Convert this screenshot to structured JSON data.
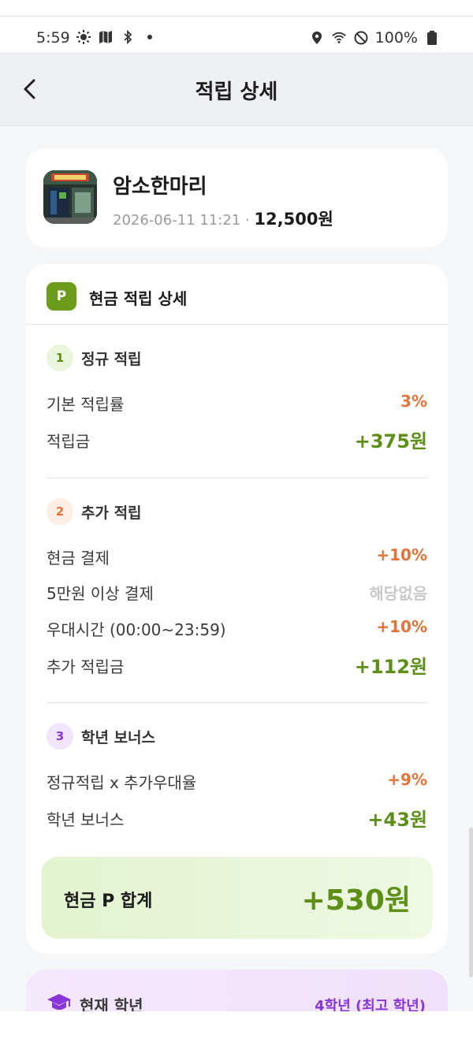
{
  "status_bar": {
    "time": "5:59",
    "battery": "100%",
    "left_icons": [
      "sun-icon",
      "map-icon",
      "bluetooth-icon",
      "dot-icon"
    ],
    "right_icons": [
      "location-icon",
      "wifi-icon",
      "do-not-disturb-icon",
      "battery-icon"
    ]
  },
  "header": {
    "title": "적립 상세",
    "back_icon": "chevron-left-icon"
  },
  "store": {
    "name": "암소한마리",
    "datetime": "2026-06-11 11:21",
    "separator": "·",
    "amount": "12,500원"
  },
  "detail": {
    "badge": "P",
    "title": "현금 적립 상세",
    "sections": [
      {
        "number": "1",
        "title": "정규 적립",
        "rows": [
          {
            "label": "기본 적립률",
            "value": "3%"
          },
          {
            "label": "적립금",
            "value": "+375원"
          }
        ]
      },
      {
        "number": "2",
        "title": "추가 적립",
        "rows": [
          {
            "label": "현금 결제",
            "value": "+10%"
          },
          {
            "label": "5만원 이상 결제",
            "value": "해당없음"
          },
          {
            "label": "우대시간 (00:00~23:59)",
            "value": "+10%"
          },
          {
            "label": "추가 적립금",
            "value": "+112원"
          }
        ]
      },
      {
        "number": "3",
        "title": "학년 보너스",
        "rows": [
          {
            "label": "정규적립 x 추가우대율",
            "value": "+9%"
          },
          {
            "label": "학년 보너스",
            "value": "+43원"
          }
        ]
      }
    ],
    "total": {
      "label": "현금 P 합계",
      "value": "+530원"
    }
  },
  "grade": {
    "icon": "graduation-cap-icon",
    "label": "현재 학년",
    "value": "4학년 (최고 학년)"
  },
  "colors": {
    "accent_green": "#5d8f18",
    "accent_orange": "#e2733a",
    "accent_purple": "#8a35d9",
    "muted_gray": "#c9c9c9"
  }
}
